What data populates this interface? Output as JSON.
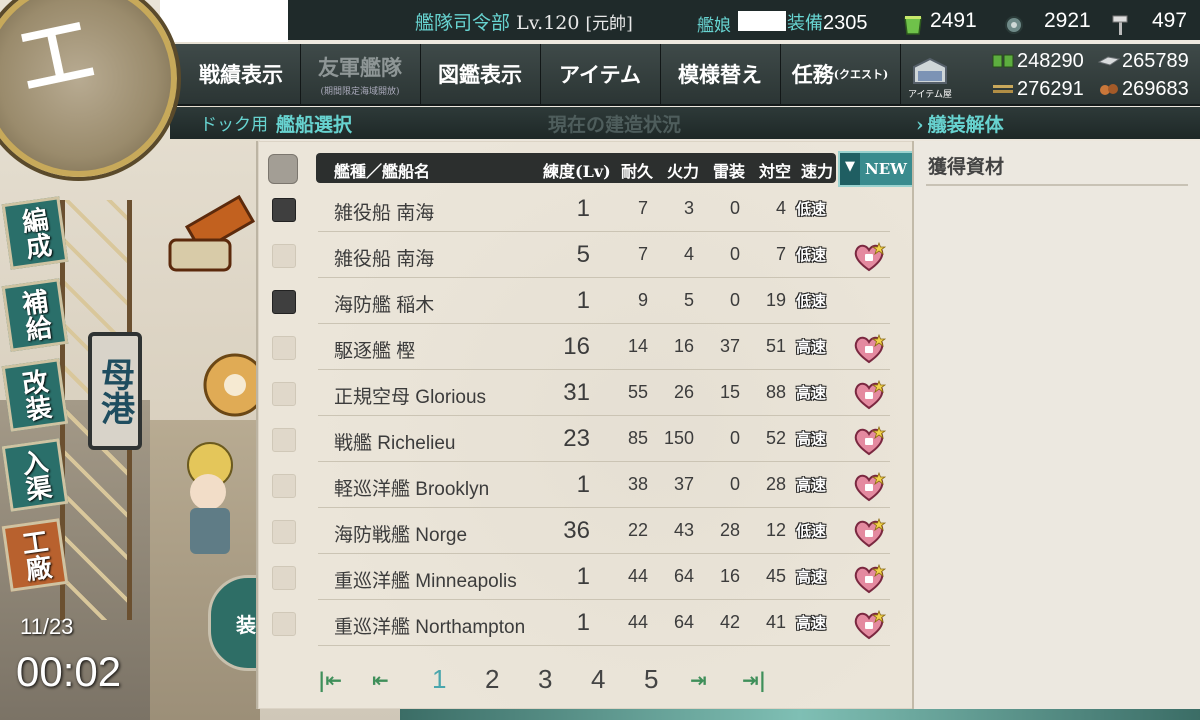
{
  "header": {
    "hq_label": "艦隊司令部",
    "hq_level": "Lv.120",
    "rank": "[元帥]",
    "ship_count_label": "艦娘",
    "equip_label": "装備",
    "equip_count": "2305",
    "fast_repair": "2491",
    "dev_material": "2921",
    "screws": "497"
  },
  "menu": {
    "items": [
      {
        "label": "戦績表示"
      },
      {
        "label": "友軍艦隊",
        "sub": "(期間限定海域開放)"
      },
      {
        "label": "図鑑表示"
      },
      {
        "label": "アイテム"
      },
      {
        "label": "模様替え"
      },
      {
        "label": "任務",
        "small": "(クエスト)"
      }
    ],
    "shop_label": "アイテム屋"
  },
  "materials": {
    "fuel": "248290",
    "steel": "265789",
    "ammo": "276291",
    "bauxite": "269683"
  },
  "breadcrumb": {
    "dock": "ドック用",
    "select": "艦船選択",
    "status": "現在の建造状況",
    "dismantle": "艤装解体"
  },
  "side_nav": {
    "badge": "工",
    "items": [
      "編成",
      "補給",
      "改装",
      "入渠",
      "工廠"
    ],
    "port": "母港"
  },
  "clock": {
    "date": "11/23",
    "time": "00:02"
  },
  "mid_button": "装",
  "table": {
    "headers": {
      "name": "艦種／艦船名",
      "lv": "練度(Lv)",
      "hp": "耐久",
      "fp": "火力",
      "tp": "雷装",
      "aa": "対空",
      "spd": "速力"
    },
    "sort_label": "NEW",
    "rows": [
      {
        "type": "雑役船",
        "name": "南海",
        "lv": "1",
        "hp": "7",
        "fp": "3",
        "tp": "0",
        "aa": "4",
        "spd": "低速",
        "checked": true,
        "lock": false
      },
      {
        "type": "雑役船",
        "name": "南海",
        "lv": "5",
        "hp": "7",
        "fp": "4",
        "tp": "0",
        "aa": "7",
        "spd": "低速",
        "checked": false,
        "lock": true
      },
      {
        "type": "海防艦",
        "name": "稲木",
        "lv": "1",
        "hp": "9",
        "fp": "5",
        "tp": "0",
        "aa": "19",
        "spd": "低速",
        "checked": true,
        "lock": false
      },
      {
        "type": "駆逐艦",
        "name": "樫",
        "lv": "16",
        "hp": "14",
        "fp": "16",
        "tp": "37",
        "aa": "51",
        "spd": "高速",
        "checked": false,
        "lock": true
      },
      {
        "type": "正規空母",
        "name": "Glorious",
        "lv": "31",
        "hp": "55",
        "fp": "26",
        "tp": "15",
        "aa": "88",
        "spd": "高速",
        "checked": false,
        "lock": true
      },
      {
        "type": "戦艦",
        "name": "Richelieu",
        "lv": "23",
        "hp": "85",
        "fp": "150",
        "tp": "0",
        "aa": "52",
        "spd": "高速",
        "checked": false,
        "lock": true
      },
      {
        "type": "軽巡洋艦",
        "name": "Brooklyn",
        "lv": "1",
        "hp": "38",
        "fp": "37",
        "tp": "0",
        "aa": "28",
        "spd": "高速",
        "checked": false,
        "lock": true
      },
      {
        "type": "海防戦艦",
        "name": "Norge",
        "lv": "36",
        "hp": "22",
        "fp": "43",
        "tp": "28",
        "aa": "12",
        "spd": "低速",
        "checked": false,
        "lock": true
      },
      {
        "type": "重巡洋艦",
        "name": "Minneapolis",
        "lv": "1",
        "hp": "44",
        "fp": "64",
        "tp": "16",
        "aa": "45",
        "spd": "高速",
        "checked": false,
        "lock": true
      },
      {
        "type": "重巡洋艦",
        "name": "Northampton",
        "lv": "1",
        "hp": "44",
        "fp": "64",
        "tp": "42",
        "aa": "41",
        "spd": "高速",
        "checked": false,
        "lock": true
      }
    ]
  },
  "pagination": {
    "pages": [
      "1",
      "2",
      "3",
      "4",
      "5"
    ],
    "current": "1"
  },
  "right_panel": {
    "title": "獲得資材"
  },
  "colors": {
    "accent": "#3a8b8e",
    "header_text": "#67d3d0",
    "page_current": "#4aa6ad"
  }
}
